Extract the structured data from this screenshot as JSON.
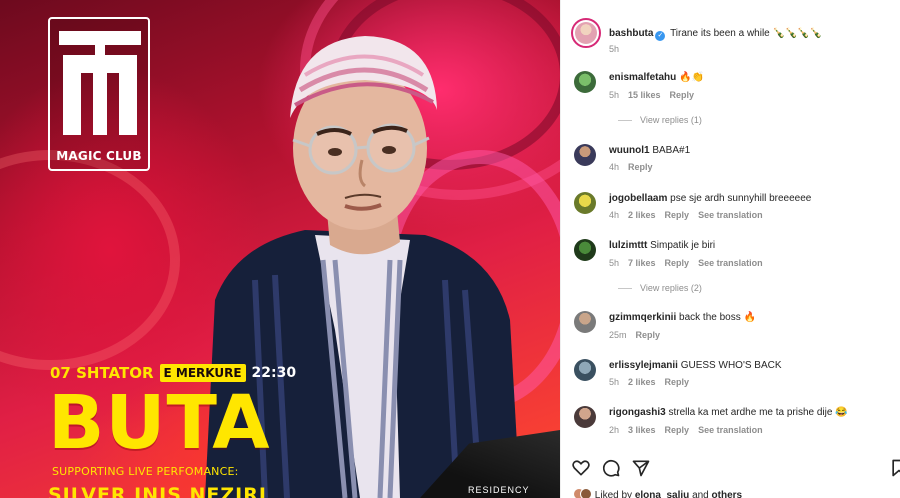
{
  "poster": {
    "logo_text": "MAGIC CLUB",
    "date": "07 SHTATOR",
    "day": "E MERKURE",
    "time": "22:30",
    "headline": "BUTA",
    "support": "SUPPORTING LIVE PERFOMANCE:",
    "artist": "SILVER INIS NEZIRI",
    "residency": "RESIDENCY"
  },
  "caption": {
    "user": "bashbuta",
    "text": "Tirane its been a while 🍾🍾🍾🍾",
    "time": "5h"
  },
  "comments": [
    {
      "user": "enismalfetahu",
      "text": "🔥👏",
      "time": "5h",
      "likes": "15 likes",
      "reply": "Reply",
      "translate": "",
      "view_replies": "View replies (1)"
    },
    {
      "user": "wuunol1",
      "text": "BABA#1",
      "time": "4h",
      "likes": "",
      "reply": "Reply",
      "translate": "",
      "view_replies": ""
    },
    {
      "user": "jogobellaam",
      "text": "pse sje ardh sunnyhill breeeeee",
      "time": "4h",
      "likes": "2 likes",
      "reply": "Reply",
      "translate": "See translation",
      "view_replies": ""
    },
    {
      "user": "lulzimttt",
      "text": "Simpatik je biri",
      "time": "5h",
      "likes": "7 likes",
      "reply": "Reply",
      "translate": "See translation",
      "view_replies": "View replies (2)"
    },
    {
      "user": "gzimmqerkinii",
      "text": "back the boss 🔥",
      "time": "25m",
      "likes": "",
      "reply": "Reply",
      "translate": "",
      "view_replies": ""
    },
    {
      "user": "erlissylejmanii",
      "text": "GUESS WHO'S BACK",
      "time": "5h",
      "likes": "2 likes",
      "reply": "Reply",
      "translate": "",
      "view_replies": ""
    },
    {
      "user": "rigongashi3",
      "text": "strella ka met ardhe me ta prishe dije 😂",
      "time": "2h",
      "likes": "3 likes",
      "reply": "Reply",
      "translate": "See translation",
      "view_replies": ""
    }
  ],
  "likes_line": {
    "prefix": "Liked by",
    "user": "elona_saliu",
    "and": "and",
    "others": "others"
  },
  "icons": [
    "heart-icon",
    "comment-icon",
    "share-icon",
    "bookmark-icon"
  ],
  "colors": {
    "accent_yellow": "#ffe600",
    "link_gray": "#8e8e8e",
    "verified_blue": "#3897f0"
  }
}
